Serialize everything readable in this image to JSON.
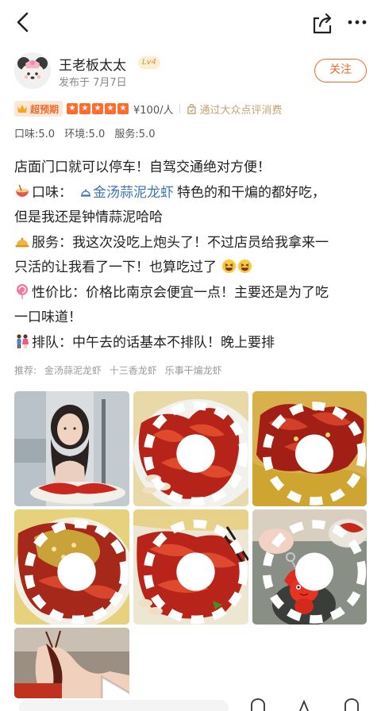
{
  "author": {
    "name": "王老板太太",
    "level": "Lv4",
    "date": "发布于 7月7日",
    "follow_label": "关注"
  },
  "rating": {
    "expect_tag": "超预期",
    "stars": 5,
    "price": "¥100/人",
    "verified": "通过大众点评消费"
  },
  "scores": {
    "taste": "口味:5.0",
    "environment": "环境:5.0",
    "service": "服务:5.0"
  },
  "content": {
    "line1": "店面门口就可以停车！自驾交通绝对方便！",
    "taste_label": "口味：",
    "dish_link": "金汤蒜泥龙虾",
    "taste_text": "特色的和干煸的都好吃，",
    "line3": "但是我还是钟情蒜泥哈哈",
    "service_text": "服务：我这次没吃上炮头了！不过店员给我拿来一",
    "line5": "只活的让我看了一下！也算吃过了",
    "value_text": "性价比：价格比南京会便宜一点！主要还是为了吃",
    "line7": "一口味道！",
    "queue_text": "排队：中午去的话基本不排队！晚上要排"
  },
  "recommend": {
    "label": "推荐:",
    "items": [
      "金汤蒜泥龙虾",
      "十三香龙虾",
      "乐事干煸龙虾"
    ]
  },
  "icons": {
    "back": "back-arrow-icon",
    "share": "share-icon",
    "more": "more-icon"
  },
  "colors": {
    "accent": "#f26a2c",
    "link": "#3d73b5",
    "star": "#ff6c2f",
    "verified": "#c4a377"
  }
}
